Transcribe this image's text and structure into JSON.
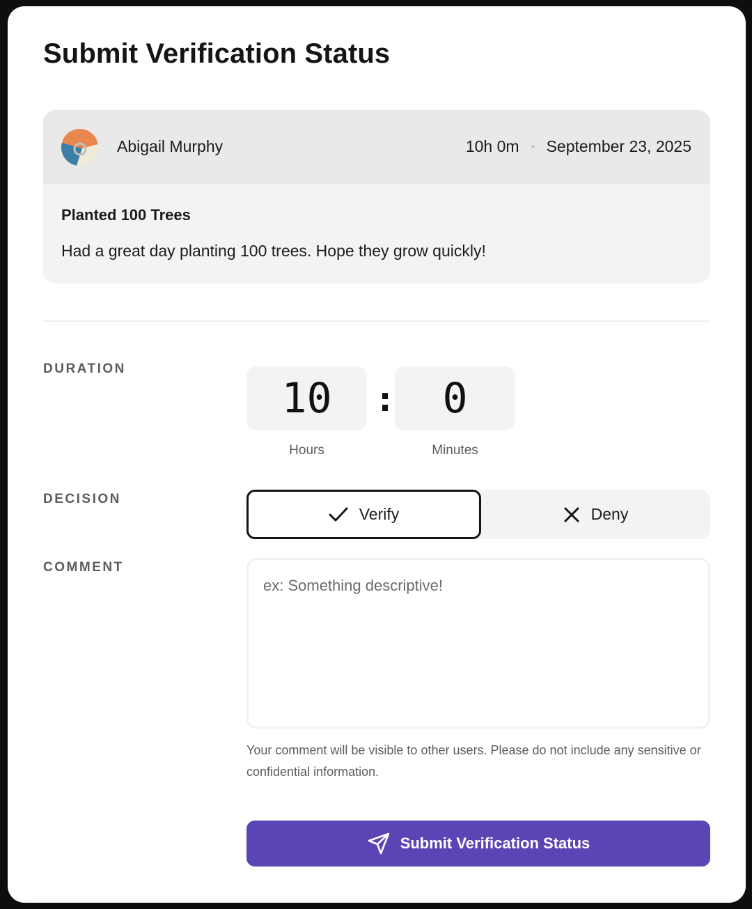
{
  "modal": {
    "title": "Submit Verification Status"
  },
  "submission": {
    "author": "Abigail Murphy",
    "duration": "10h 0m",
    "date": "September 23, 2025",
    "title": "Planted 100 Trees",
    "description": "Had a great day planting 100 trees. Hope they grow quickly!",
    "avatar_icon": "avatar-abstract-icon"
  },
  "form": {
    "duration_label": "DURATION",
    "hours_value": "10",
    "minutes_value": "0",
    "separator": ":",
    "hours_caption": "Hours",
    "minutes_caption": "Minutes",
    "decision_label": "DECISION",
    "verify_label": "Verify",
    "deny_label": "Deny",
    "selected_decision": "Verify",
    "comment_label": "COMMENT",
    "comment_placeholder": "ex: Something descriptive!",
    "comment_value": "",
    "hint": "Your comment will be visible to other users. Please do not include any sensitive or confidential information.",
    "submit_label": "Submit Verification Status",
    "submit_icon": "send-icon"
  },
  "colors": {
    "accent": "#5b44b4",
    "card_bg": "#f3f3f4",
    "card_header_bg": "#e9e9ea"
  }
}
